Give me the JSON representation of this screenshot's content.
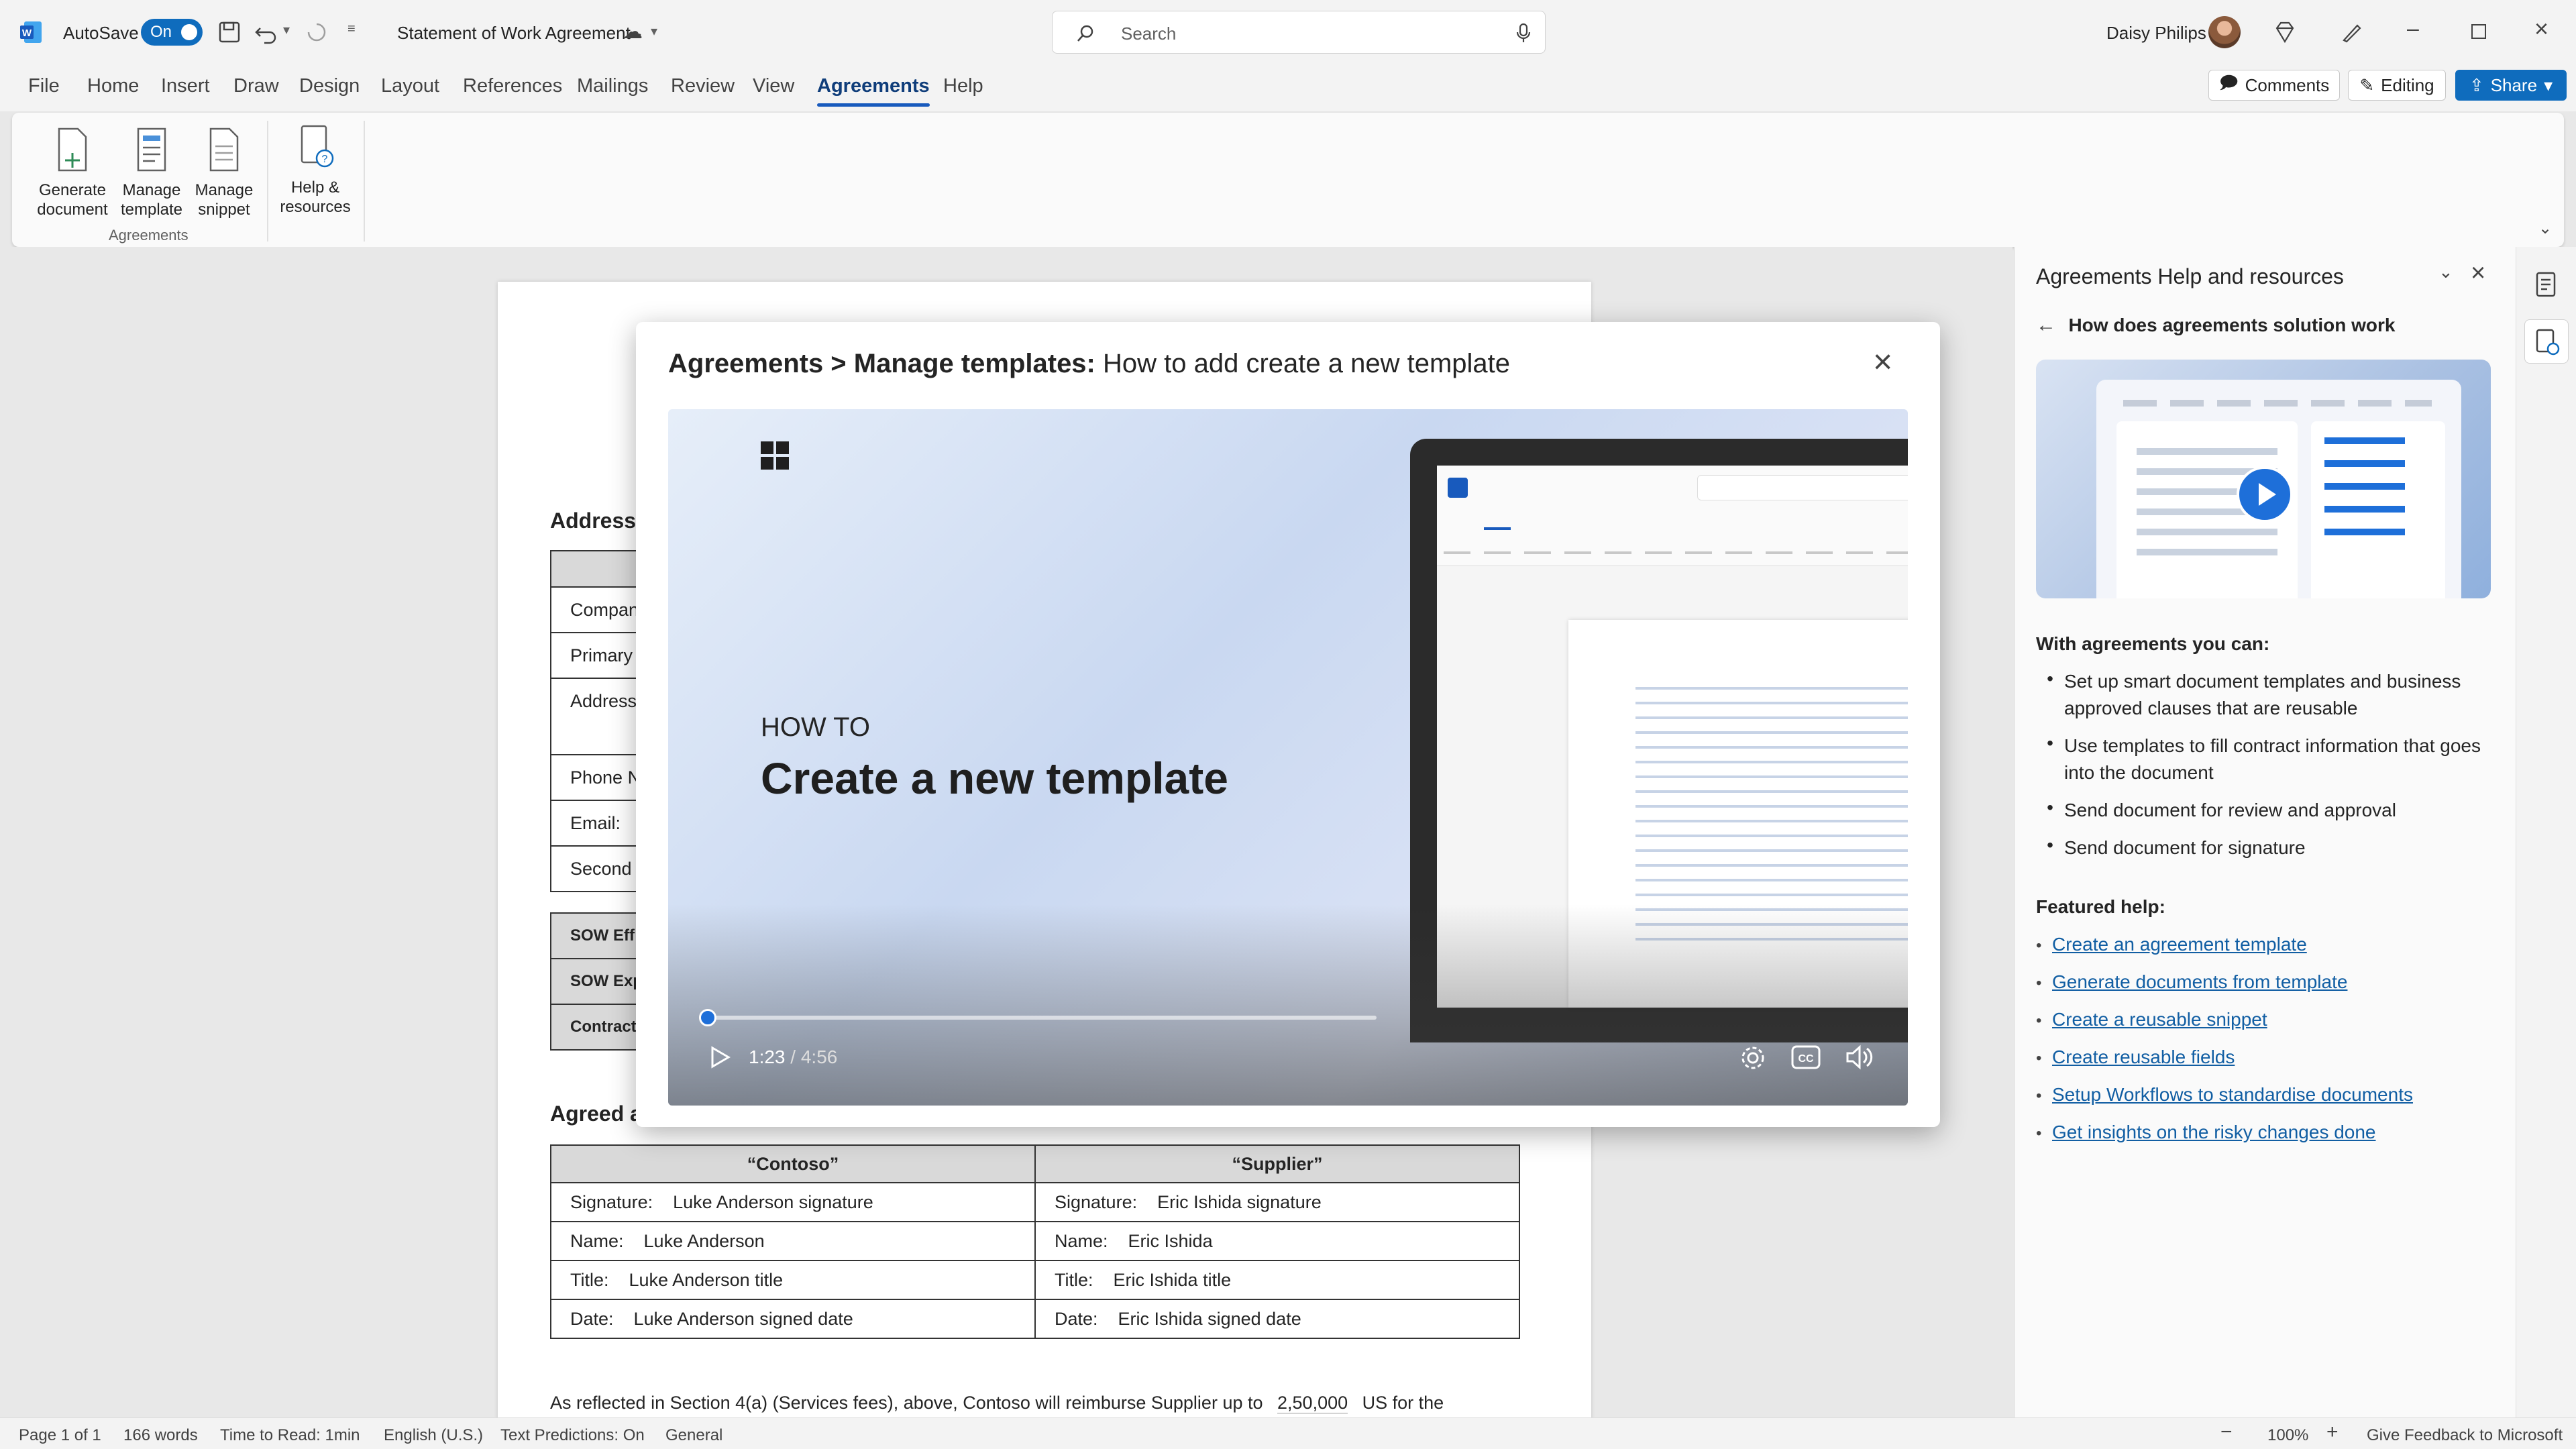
{
  "titlebar": {
    "autosave_label": "AutoSave",
    "autosave_state": "On",
    "doc_title": "Statement of Work Agreement",
    "search_placeholder": "Search",
    "user_name": "Daisy Philips"
  },
  "menu": {
    "tabs": [
      "File",
      "Home",
      "Insert",
      "Draw",
      "Design",
      "Layout",
      "References",
      "Mailings",
      "Review",
      "View",
      "Agreements",
      "Help"
    ],
    "active": "Agreements",
    "comments": "Comments",
    "editing": "Editing",
    "share": "Share"
  },
  "ribbon": {
    "buttons": [
      {
        "line1": "Generate",
        "line2": "document"
      },
      {
        "line1": "Manage",
        "line2": "template"
      },
      {
        "line1": "Manage",
        "line2": "snippet"
      },
      {
        "line1": "Help &",
        "line2": "resources"
      }
    ],
    "group_label": "Agreements"
  },
  "document": {
    "heading_addresses": "Addresse",
    "rows": [
      "Compan",
      "Primary",
      "Address",
      "Phone N",
      "Email:",
      "Second"
    ],
    "sow_rows": [
      "SOW Eff",
      "SOW Exp",
      "Contract"
    ],
    "agreed_heading": "Agreed a",
    "sign_table": {
      "contoso_header": "“Contoso”",
      "supplier_header": "“Supplier”",
      "rows": [
        {
          "label": "Signature:",
          "left": "Luke Anderson signature",
          "right": "Eric Ishida signature"
        },
        {
          "label": "Name:",
          "left": "Luke Anderson",
          "right": "Eric Ishida"
        },
        {
          "label": "Title:",
          "left": "Luke Anderson title",
          "right": "Eric Ishida title"
        },
        {
          "label": "Date:",
          "left": "Luke Anderson signed date",
          "right": "Eric Ishida signed date"
        }
      ]
    },
    "footer_text_1": "As reflected in Section 4(a) (Services fees), above, Contoso will reimburse Supplier up to",
    "footer_amount": "2,50,000",
    "footer_text_2": "US for the"
  },
  "dialog": {
    "title_bold": "Agreements > Manage templates:",
    "title_rest": " How to add create a new template",
    "video": {
      "kicker": "HOW TO",
      "headline": "Create a new template",
      "time_current": "1:23",
      "time_sep": " / ",
      "time_total": "4:56",
      "progress": 0.0
    }
  },
  "pane": {
    "title": "Agreements Help and resources",
    "back_label": "How does agreements solution work",
    "intro": "With agreements you can:",
    "bullets": [
      "Set up smart document templates and business approved clauses that are reusable",
      "Use templates to fill contract information that goes into the document",
      "Send document for review and approval",
      "Send document for signature"
    ],
    "featured_label": "Featured help:",
    "links": [
      "Create an agreement template",
      "Generate documents from template",
      "Create a reusable snippet",
      "Create reusable fields",
      "Setup Workflows to standardise documents",
      "Get insights on the risky changes done"
    ]
  },
  "status": {
    "page": "Page 1 of 1",
    "words": "166 words",
    "read_time": "Time to Read: 1min",
    "language": "English (U.S.)",
    "predictions": "Text Predictions: On",
    "general": "General",
    "zoom": "100%",
    "feedback": "Give Feedback to Microsoft"
  }
}
